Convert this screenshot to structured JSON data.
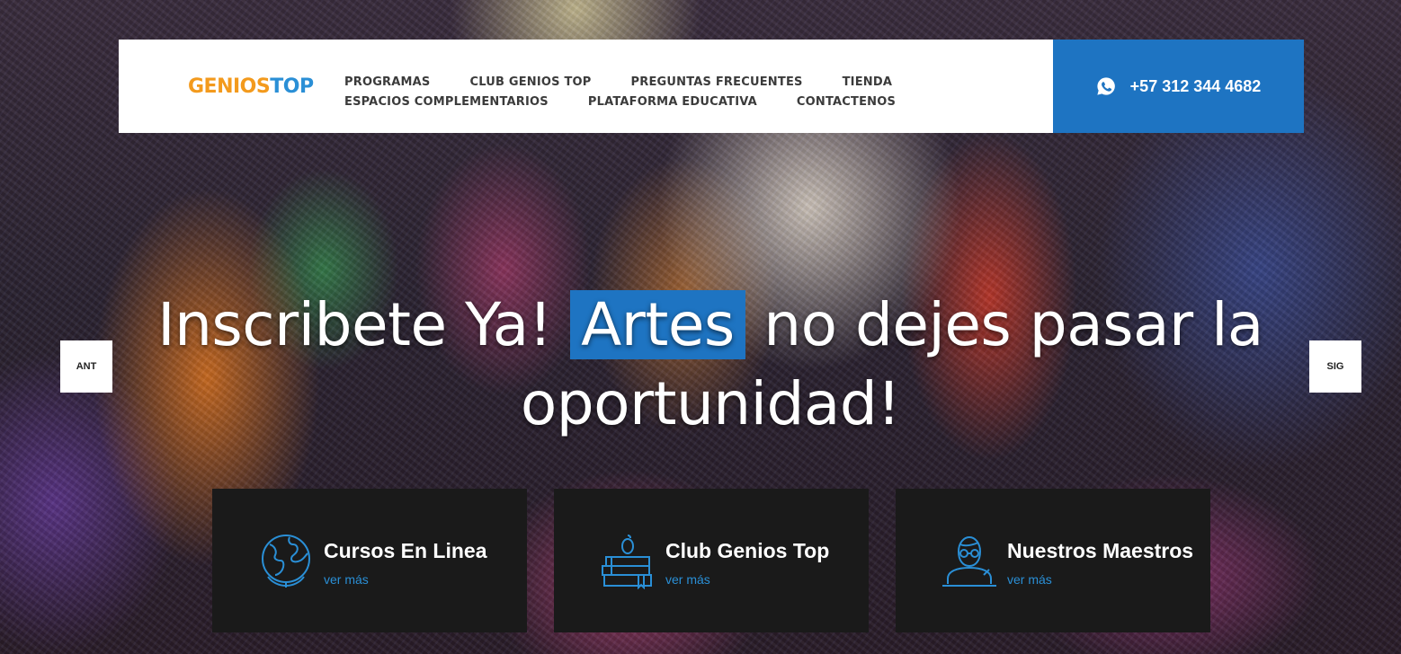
{
  "header": {
    "logo": {
      "part1": "GENIOS",
      "part2": "TOP"
    },
    "nav_row1": [
      "PROGRAMAS",
      "CLUB GENIOS TOP",
      "PREGUNTAS FRECUENTES",
      "TIENDA"
    ],
    "nav_row2": [
      "ESPACIOS COMPLEMENTARIOS",
      "PLATAFORMA EDUCATIVA",
      "CONTACTENOS"
    ],
    "phone": "+57 312 344 4682",
    "phone_icon": "whatsapp-icon"
  },
  "hero": {
    "headline_part1": "Inscribete Ya!",
    "headline_highlight": "Artes",
    "headline_part2": "no dejes pasar la oportunidad!",
    "prev_label": "ANT",
    "next_label": "SIG"
  },
  "cards": [
    {
      "title": "Cursos En Linea",
      "more": "ver más",
      "icon": "globe-icon"
    },
    {
      "title": "Club Genios Top",
      "more": "ver más",
      "icon": "books-apple-icon"
    },
    {
      "title": "Nuestros Maestros",
      "more": "ver más",
      "icon": "teacher-icon"
    }
  ],
  "colors": {
    "accent": "#1e74c2",
    "logo_orange": "#f39a1d",
    "card_bg": "#1a1a1a"
  }
}
